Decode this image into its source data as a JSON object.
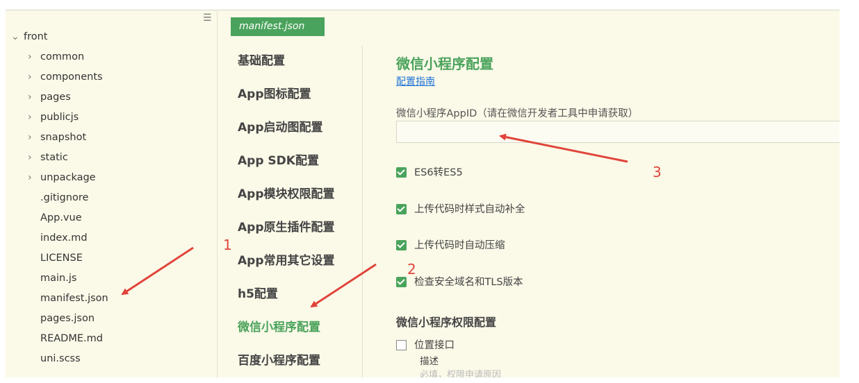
{
  "file_tree": {
    "root": "front",
    "items": [
      {
        "label": "common",
        "folder": true
      },
      {
        "label": "components",
        "folder": true
      },
      {
        "label": "pages",
        "folder": true
      },
      {
        "label": "publicjs",
        "folder": true
      },
      {
        "label": "snapshot",
        "folder": true
      },
      {
        "label": "static",
        "folder": true
      },
      {
        "label": "unpackage",
        "folder": true
      },
      {
        "label": ".gitignore",
        "folder": false
      },
      {
        "label": "App.vue",
        "folder": false
      },
      {
        "label": "index.md",
        "folder": false
      },
      {
        "label": "LICENSE",
        "folder": false
      },
      {
        "label": "main.js",
        "folder": false
      },
      {
        "label": "manifest.json",
        "folder": false
      },
      {
        "label": "pages.json",
        "folder": false
      },
      {
        "label": "README.md",
        "folder": false
      },
      {
        "label": "uni.scss",
        "folder": false
      }
    ],
    "menu_icon": "hamburger-icon"
  },
  "editor_tab": "manifest.json",
  "settings_nav": [
    "基础配置",
    "App图标配置",
    "App启动图配置",
    "App SDK配置",
    "App模块权限配置",
    "App原生插件配置",
    "App常用其它设置",
    "h5配置",
    "微信小程序配置",
    "百度小程序配置"
  ],
  "active_nav": "微信小程序配置",
  "content": {
    "title": "微信小程序配置",
    "guide_link": "配置指南",
    "appid_label": "微信小程序AppID（请在微信开发者工具中申请获取）",
    "appid_value": "",
    "checkboxes": [
      {
        "label": "ES6转ES5",
        "checked": true
      },
      {
        "label": "上传代码时样式自动补全",
        "checked": true
      },
      {
        "label": "上传代码时自动压缩",
        "checked": true
      },
      {
        "label": "检查安全域名和TLS版本",
        "checked": true
      }
    ],
    "permissions_title": "微信小程序权限配置",
    "location_label": "位置接口",
    "location_checked": false,
    "desc_label": "描述",
    "desc_hint": "必填，权限申请原因"
  },
  "annotations": [
    "1",
    "2",
    "3"
  ],
  "colors": {
    "accent": "#4aa35c",
    "annotation": "#e0443a",
    "link": "#1e73d8",
    "background": "#fbf9e8"
  }
}
